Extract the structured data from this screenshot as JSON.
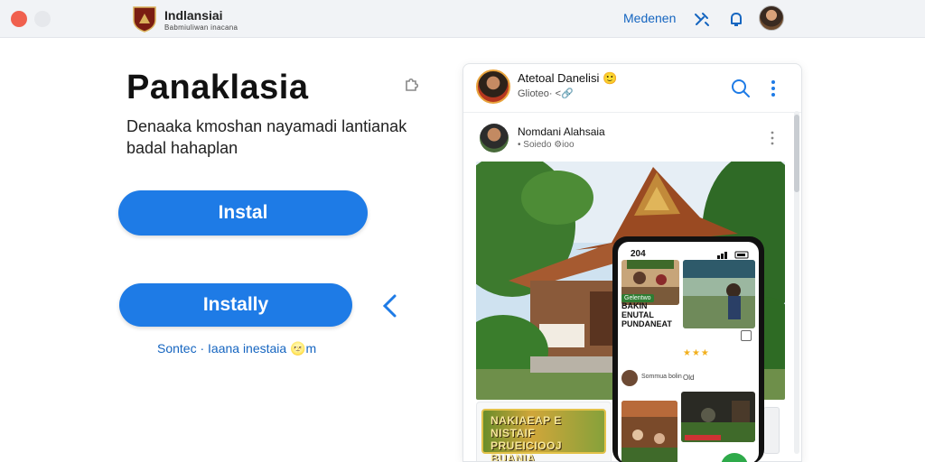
{
  "topbar": {
    "brand": "Indlansiai",
    "brand_sub": "Babmiuliwan inacana",
    "nav_link": "Medenen",
    "icons": [
      "tools-icon",
      "bell-icon",
      "avatar"
    ]
  },
  "hero": {
    "title": "Panaklasia",
    "description": "Denaaka kmoshan nayamadi lantianak badal hahaplan",
    "primary_button": "Instal",
    "secondary_button": "Instally",
    "footnote": "Sontec · Iaana inestaia 🌝m"
  },
  "mock": {
    "account_name": "Atetoal Danelisi 🙂",
    "account_handle": "Glioteo· <🔗",
    "post_author": "Nomdani Alahsaia",
    "post_meta": "• Soiedo ⚙ioo",
    "banner_text": "NAKIAEAP E NISTAIF PRUEICIOOJ BUANIA"
  },
  "phone": {
    "time": "204",
    "tile_tag": "Gelentwo",
    "tile_label": "BAKIN ENUTAL PUNDANEAT",
    "stars": "★★★",
    "comment_name": "Sommua bolin",
    "comment_count": "Old"
  },
  "colors": {
    "primary": "#1e7be6",
    "link": "#1565c0",
    "close": "#f0604e",
    "fab": "#2eaa4a"
  }
}
